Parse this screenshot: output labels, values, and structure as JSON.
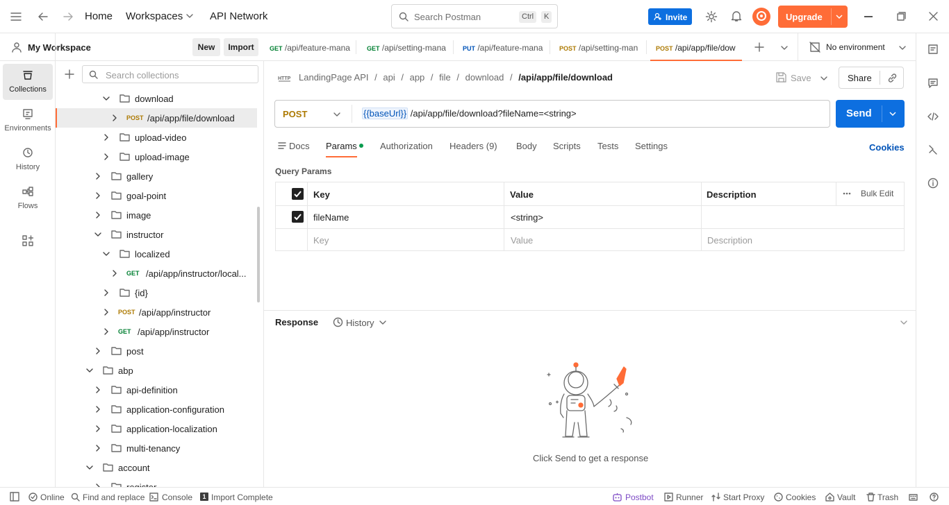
{
  "topbar": {
    "nav": [
      "Home",
      "Workspaces",
      "API Network"
    ],
    "search_placeholder": "Search Postman",
    "shortcut_keys": [
      "Ctrl",
      "K"
    ],
    "invite_label": "Invite",
    "upgrade_label": "Upgrade"
  },
  "sidebar": {
    "workspace_name": "My Workspace",
    "new_label": "New",
    "import_label": "Import",
    "rail": [
      {
        "label": "Collections",
        "icon": "collections-icon"
      },
      {
        "label": "Environments",
        "icon": "environments-icon"
      },
      {
        "label": "History",
        "icon": "history-icon"
      },
      {
        "label": "Flows",
        "icon": "flows-icon"
      }
    ],
    "search_placeholder": "Search collections",
    "tree": [
      {
        "indent": 2,
        "type": "folder",
        "expanded": true,
        "label": "download"
      },
      {
        "indent": 3,
        "type": "request",
        "method": "POST",
        "label": "/api/app/file/download",
        "selected": true
      },
      {
        "indent": 2,
        "type": "folder",
        "expanded": false,
        "label": "upload-video"
      },
      {
        "indent": 2,
        "type": "folder",
        "expanded": false,
        "label": "upload-image"
      },
      {
        "indent": 1,
        "type": "folder",
        "expanded": false,
        "label": "gallery"
      },
      {
        "indent": 1,
        "type": "folder",
        "expanded": false,
        "label": "goal-point"
      },
      {
        "indent": 1,
        "type": "folder",
        "expanded": false,
        "label": "image"
      },
      {
        "indent": 1,
        "type": "folder",
        "expanded": true,
        "label": "instructor"
      },
      {
        "indent": 2,
        "type": "folder",
        "expanded": true,
        "label": "localized"
      },
      {
        "indent": 3,
        "type": "request",
        "method": "GET",
        "label": "/api/app/instructor/local..."
      },
      {
        "indent": 2,
        "type": "folder",
        "expanded": false,
        "label": "{id}"
      },
      {
        "indent": 2,
        "type": "request",
        "method": "POST",
        "label": "/api/app/instructor"
      },
      {
        "indent": 2,
        "type": "request",
        "method": "GET",
        "label": "/api/app/instructor"
      },
      {
        "indent": 1,
        "type": "folder",
        "expanded": false,
        "label": "post"
      },
      {
        "indent": 0,
        "type": "folder",
        "expanded": true,
        "label": "abp"
      },
      {
        "indent": 1,
        "type": "folder",
        "expanded": false,
        "label": "api-definition"
      },
      {
        "indent": 1,
        "type": "folder",
        "expanded": false,
        "label": "application-configuration"
      },
      {
        "indent": 1,
        "type": "folder",
        "expanded": false,
        "label": "application-localization"
      },
      {
        "indent": 1,
        "type": "folder",
        "expanded": false,
        "label": "multi-tenancy"
      },
      {
        "indent": 0,
        "type": "folder",
        "expanded": true,
        "label": "account"
      },
      {
        "indent": 1,
        "type": "folder",
        "expanded": false,
        "label": "register"
      }
    ]
  },
  "tabs": [
    {
      "method": "GET",
      "label": "/api/feature-mana"
    },
    {
      "method": "GET",
      "label": "/api/setting-mana"
    },
    {
      "method": "PUT",
      "label": "/api/feature-mana"
    },
    {
      "method": "POST",
      "label": "/api/setting-man"
    },
    {
      "method": "POST",
      "label": "/api/app/file/dow",
      "active": true
    }
  ],
  "environment": "No environment",
  "request": {
    "breadcrumb": [
      "LandingPage API",
      "api",
      "app",
      "file",
      "download"
    ],
    "breadcrumb_current": "/api/app/file/download",
    "save_label": "Save",
    "share_label": "Share",
    "method": "POST",
    "url_variable": "{{baseUrl}}",
    "url_rest": " /api/app/file/download?fileName=<string>",
    "send_label": "Send",
    "tabs": [
      "Docs",
      "Params",
      "Authorization",
      "Headers (9)",
      "Body",
      "Scripts",
      "Tests",
      "Settings"
    ],
    "active_tab": "Params",
    "cookies_label": "Cookies",
    "query_params_title": "Query Params",
    "columns": [
      "Key",
      "Value",
      "Description"
    ],
    "bulk_edit_label": "Bulk Edit",
    "params": [
      {
        "checked": true,
        "key": "fileName",
        "value": "<string>",
        "description": ""
      }
    ],
    "new_row_placeholders": {
      "key": "Key",
      "value": "Value",
      "description": "Description"
    }
  },
  "response": {
    "title": "Response",
    "history_label": "History",
    "empty_message": "Click Send to get a response"
  },
  "statusbar": {
    "left": [
      "Online",
      "Find and replace",
      "Console",
      "Import Complete"
    ],
    "right": [
      "Postbot",
      "Runner",
      "Start Proxy",
      "Cookies",
      "Vault",
      "Trash"
    ]
  },
  "colors": {
    "accent": "#ff6c37",
    "primary": "#0d6fe0",
    "get": "#007f31",
    "post": "#ad7a03",
    "put": "#0053b8"
  }
}
